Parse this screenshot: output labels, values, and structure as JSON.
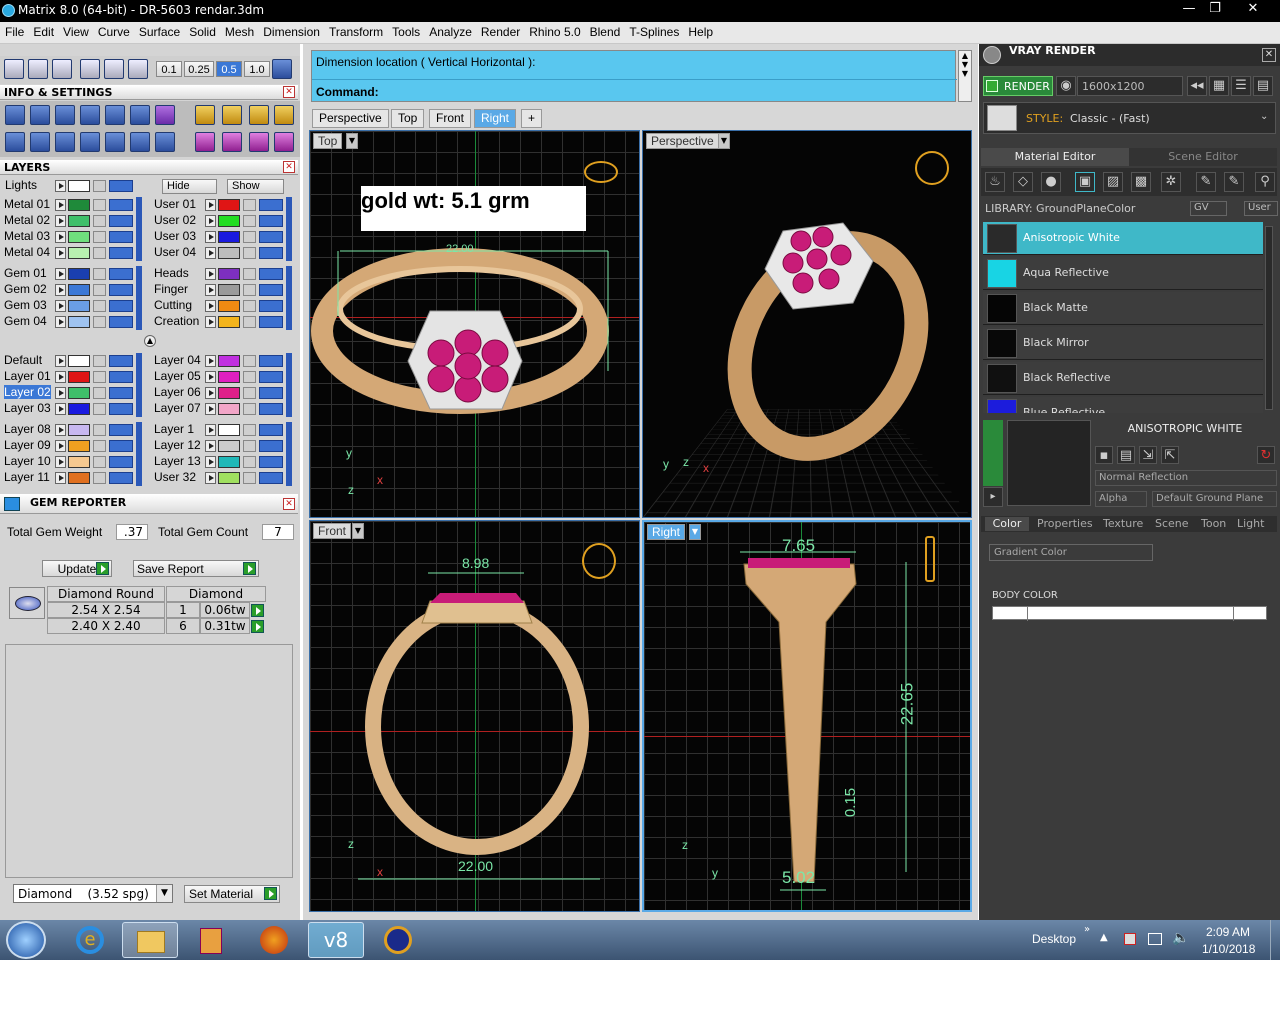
{
  "window": {
    "title": "Matrix 8.0 (64-bit) - DR-5603 rendar.3dm",
    "minimize": "—",
    "maximize": "❐",
    "close": "✕"
  },
  "menu": [
    "File",
    "Edit",
    "View",
    "Curve",
    "Surface",
    "Solid",
    "Mesh",
    "Dimension",
    "Transform",
    "Tools",
    "Analyze",
    "Render",
    "Rhino 5.0",
    "Blend",
    "T-Splines",
    "Help"
  ],
  "toolbar": {
    "snaps": [
      "0.1",
      "0.25",
      "0.5",
      "1.0"
    ]
  },
  "info_settings": {
    "title": "INFO & SETTINGS"
  },
  "layers": {
    "title": "LAYERS",
    "lights_label": "Lights",
    "hide_label": "Hide",
    "show_label": "Show",
    "left_group1": [
      {
        "name": "Metal 01",
        "color": "#1f8a3a"
      },
      {
        "name": "Metal 02",
        "color": "#3fbf6a"
      },
      {
        "name": "Metal 03",
        "color": "#6fe07d"
      },
      {
        "name": "Metal 04",
        "color": "#b8f0b0"
      }
    ],
    "right_group1": [
      {
        "name": "User 01",
        "color": "#e01515"
      },
      {
        "name": "User 02",
        "color": "#22dd22"
      },
      {
        "name": "User 03",
        "color": "#1a1adf"
      },
      {
        "name": "User 04",
        "color": "#bdbdbd"
      }
    ],
    "left_group2": [
      {
        "name": "Gem 01",
        "color": "#1a3fb0"
      },
      {
        "name": "Gem 02",
        "color": "#3b78d6"
      },
      {
        "name": "Gem 03",
        "color": "#6a9ee6"
      },
      {
        "name": "Gem 04",
        "color": "#9fc3f0"
      }
    ],
    "right_group2": [
      {
        "name": "Heads",
        "color": "#7d2fc0"
      },
      {
        "name": "Finger",
        "color": "#9a9a9a"
      },
      {
        "name": "Cutting",
        "color": "#f08a12"
      },
      {
        "name": "Creation",
        "color": "#f3b41c"
      }
    ],
    "left_group3": [
      {
        "name": "Default",
        "color": "#ffffff"
      },
      {
        "name": "Layer 01",
        "color": "#e01515"
      },
      {
        "name": "Layer 02",
        "color": "#3fbf6a"
      },
      {
        "name": "Layer 03",
        "color": "#1a1adf"
      }
    ],
    "right_group3": [
      {
        "name": "Layer 04",
        "color": "#c030e0"
      },
      {
        "name": "Layer 05",
        "color": "#e020c0"
      },
      {
        "name": "Layer 06",
        "color": "#e0208a"
      },
      {
        "name": "Layer 07",
        "color": "#f2a6c8"
      }
    ],
    "left_group4": [
      {
        "name": "Layer 08",
        "color": "#c8b8f0"
      },
      {
        "name": "Layer 09",
        "color": "#f0a020"
      },
      {
        "name": "Layer 10",
        "color": "#f5c890"
      },
      {
        "name": "Layer 11",
        "color": "#e07020"
      }
    ],
    "right_group4": [
      {
        "name": "Layer 1",
        "color": "#ffffff"
      },
      {
        "name": "Layer 12",
        "color": "#cccccc"
      },
      {
        "name": "Layer 13",
        "color": "#20b8b8"
      },
      {
        "name": "User 32",
        "color": "#a0e060"
      }
    ]
  },
  "gem_reporter": {
    "title": "GEM REPORTER",
    "total_weight_label": "Total Gem Weight",
    "total_weight": ".37",
    "total_count_label": "Total Gem Count",
    "total_count": "7",
    "update_label": "Update",
    "save_label": "Save Report",
    "col1": "Diamond Round",
    "col2": "Diamond",
    "rows": [
      {
        "size": "2.54 X 2.54",
        "qty": "1",
        "wt": "0.06tw"
      },
      {
        "size": "2.40 X 2.40",
        "qty": "6",
        "wt": "0.31tw"
      }
    ],
    "material_select": "Diamond    (3.52 spg)",
    "set_material": "Set Material"
  },
  "command": {
    "prompt": "Dimension location ( Vertical  Horizontal ):",
    "label": "Command:",
    "value": ""
  },
  "view_tabs": [
    "Perspective",
    "Top",
    "Front",
    "Right",
    "+"
  ],
  "viewports": {
    "top": {
      "label": "Top",
      "note": "gold wt: 5.1 grm",
      "dim": "22.00"
    },
    "perspective": {
      "label": "Perspective"
    },
    "front": {
      "label": "Front",
      "dim_top": "8.98",
      "dim_bottom": "22.00"
    },
    "right": {
      "label": "Right",
      "dim_top": "7.65",
      "dim_side": "22.65",
      "dim_small": "0.15",
      "dim_bottom": "5.02"
    }
  },
  "axes": {
    "x": "x",
    "y": "y",
    "z": "z"
  },
  "vray": {
    "title": "VRAY RENDER",
    "render_label": "RENDER",
    "resolution": "1600x1200",
    "style_label": "STYLE:",
    "style_value": "Classic - (Fast)",
    "tabs": [
      "Material Editor",
      "Scene Editor"
    ],
    "library_label": "LIBRARY: GroundPlaneColor",
    "gv": "GV",
    "user": "User",
    "materials": [
      {
        "name": "Anisotropic White",
        "color": "#2a2a2a"
      },
      {
        "name": "Aqua Reflective",
        "color": "#18d4e4"
      },
      {
        "name": "Black Matte",
        "color": "#050505"
      },
      {
        "name": "Black Mirror",
        "color": "#080808"
      },
      {
        "name": "Black Reflective",
        "color": "#101010"
      },
      {
        "name": "Blue Reflective",
        "color": "#1c1cdc"
      }
    ],
    "selected_title": "ANISOTROPIC WHITE",
    "reflection": "Normal Reflection",
    "alpha_label": "Alpha",
    "ground_plane": "Default Ground Plane",
    "prop_tabs": [
      "Color",
      "Properties",
      "Texture",
      "Scene",
      "Toon",
      "Light"
    ],
    "gradient_select": "Gradient Color",
    "body_color_label": "BODY COLOR"
  },
  "taskbar": {
    "desktop": "Desktop",
    "time": "2:09 AM",
    "date": "1/10/2018",
    "app_label": "v8"
  }
}
